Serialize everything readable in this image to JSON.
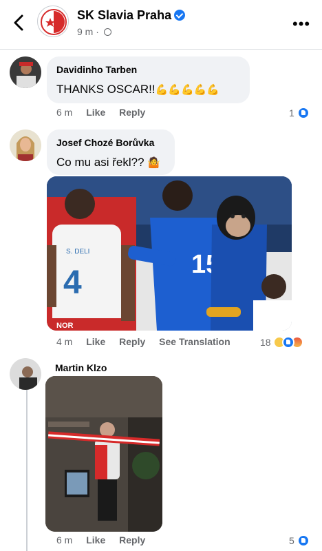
{
  "header": {
    "page_name": "SK Slavia Praha",
    "time": "9 m",
    "separator": "·"
  },
  "comments": [
    {
      "author": "Davidinho Tarben",
      "text": "THANKS  OSCAR!!",
      "emoji": "💪💪💪💪💪",
      "time": "6 m",
      "like": "Like",
      "reply": "Reply",
      "reaction_count": "1"
    },
    {
      "author": "Josef Chozé Borůvka",
      "text": "Co mu asi řekl??",
      "emoji": "🤷",
      "time": "4 m",
      "like": "Like",
      "reply": "Reply",
      "translate": "See Translation",
      "reaction_count": "18",
      "photo": {
        "shirt_name": "S. DELI",
        "shirt_number": "4",
        "opponent_number": "15",
        "sponsor": "NOR"
      }
    },
    {
      "author": "Martin Klzo",
      "time": "6 m",
      "like": "Like",
      "reply": "Reply",
      "reaction_count": "5"
    }
  ],
  "colors": {
    "accent": "#1877f2",
    "bubble": "#f0f2f5",
    "secondary_text": "#65676b",
    "slavia_red": "#d62a2a"
  }
}
